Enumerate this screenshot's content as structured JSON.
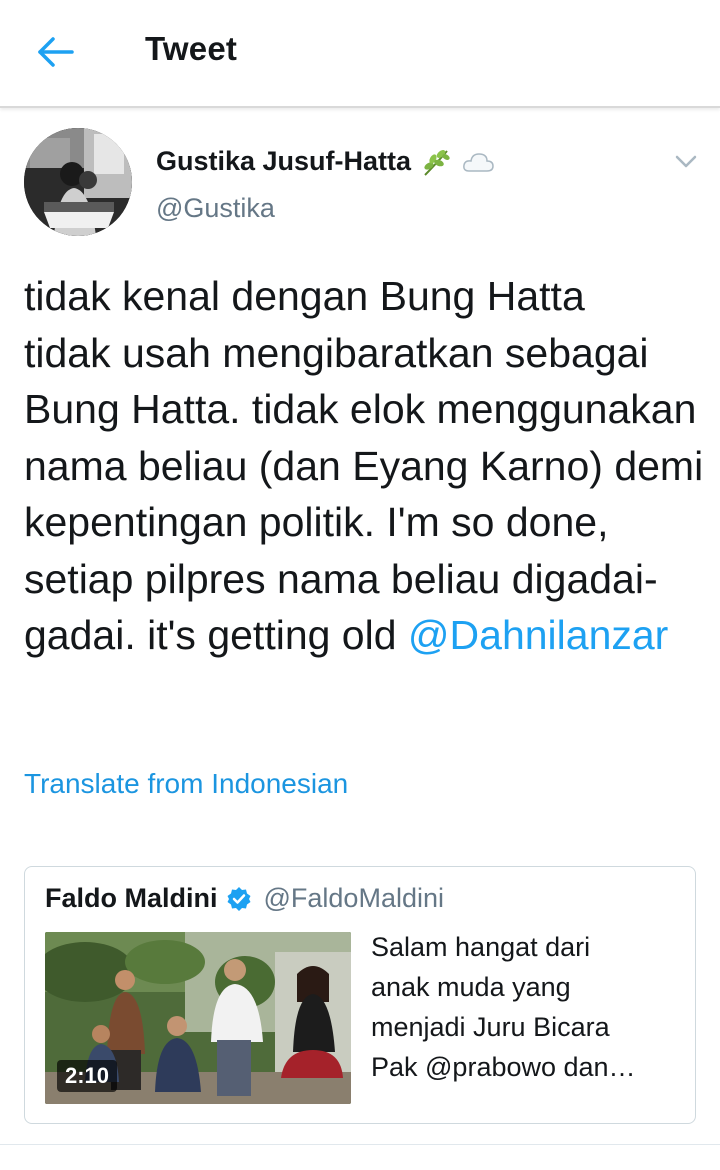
{
  "header": {
    "title": "Tweet",
    "back_icon": "arrow-left-icon",
    "accent": "#1da1f2"
  },
  "tweet": {
    "author_name": "Gustika Jusuf-Hatta",
    "author_handle": "@Gustika",
    "name_emojis": [
      "herb-emoji-icon",
      "cloud-emoji-icon"
    ],
    "text_before_mention": "tidak kenal dengan Bung Hatta\ntidak usah mengibaratkan sebagai Bung Hatta. tidak elok menggunakan nama beliau (dan Eyang Karno) demi kepentingan politik. I'm so done, setiap pilpres nama beliau digadai-gadai. it's getting old ",
    "mention": "@Dahnilanzar",
    "translate_label": "Translate from Indonesian"
  },
  "quoted_tweet": {
    "author_name": "Faldo Maldini",
    "author_handle": "@FaldoMaldini",
    "verified_icon": "verified-badge-icon",
    "text": "Salam hangat dari\nanak muda yang\nmenjadi Juru Bicara\nPak @prabowo dan…",
    "video_duration": "2:10"
  },
  "colors": {
    "text": "#14171a",
    "secondary": "#657786",
    "link": "#1da1f2",
    "translate": "#1b95e0",
    "border": "#cfd9de"
  }
}
